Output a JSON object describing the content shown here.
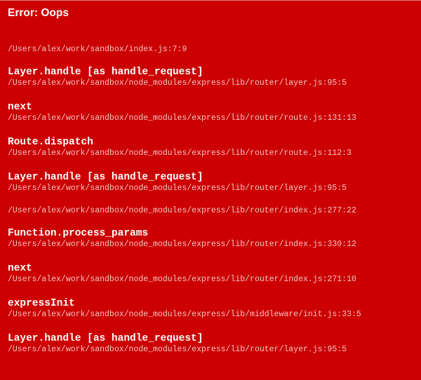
{
  "error": {
    "title": "Error: Oops"
  },
  "stack": [
    {
      "fn": "",
      "loc": "/Users/alex/work/sandbox/index.js:7:9"
    },
    {
      "fn": "Layer.handle [as handle_request]",
      "loc": "/Users/alex/work/sandbox/node_modules/express/lib/router/layer.js:95:5"
    },
    {
      "fn": "next",
      "loc": "/Users/alex/work/sandbox/node_modules/express/lib/router/route.js:131:13"
    },
    {
      "fn": "Route.dispatch",
      "loc": "/Users/alex/work/sandbox/node_modules/express/lib/router/route.js:112:3"
    },
    {
      "fn": "Layer.handle [as handle_request]",
      "loc": "/Users/alex/work/sandbox/node_modules/express/lib/router/layer.js:95:5"
    },
    {
      "fn": "",
      "loc": "/Users/alex/work/sandbox/node_modules/express/lib/router/index.js:277:22"
    },
    {
      "fn": "Function.process_params",
      "loc": "/Users/alex/work/sandbox/node_modules/express/lib/router/index.js:330:12"
    },
    {
      "fn": "next",
      "loc": "/Users/alex/work/sandbox/node_modules/express/lib/router/index.js:271:10"
    },
    {
      "fn": "expressInit",
      "loc": "/Users/alex/work/sandbox/node_modules/express/lib/middleware/init.js:33:5"
    },
    {
      "fn": "Layer.handle [as handle_request]",
      "loc": "/Users/alex/work/sandbox/node_modules/express/lib/router/layer.js:95:5"
    }
  ],
  "colors": {
    "background": "#cc0000",
    "function_text": "#ffffff",
    "location_text": "#f2c3c3"
  }
}
